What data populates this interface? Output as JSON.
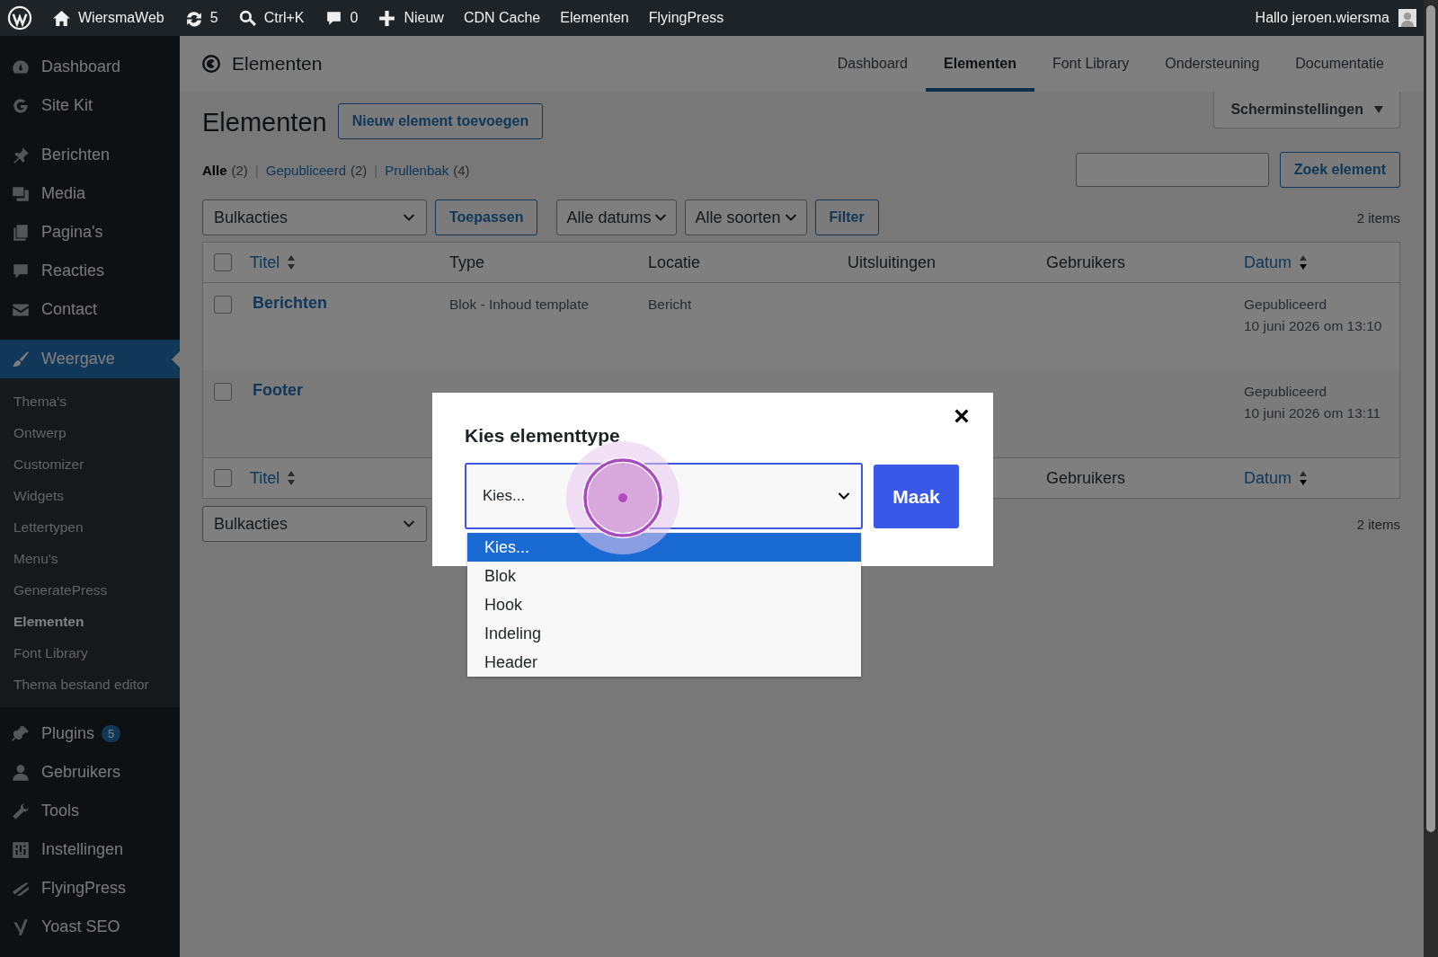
{
  "admin_bar": {
    "items": [
      {
        "label": "WiersmaWeb"
      },
      {
        "label": "5"
      },
      {
        "label": "Ctrl+K"
      },
      {
        "label": "0"
      },
      {
        "label": "Nieuw"
      },
      {
        "label": "CDN Cache"
      },
      {
        "label": "Elementen"
      },
      {
        "label": "FlyingPress"
      }
    ],
    "greeting": "Hallo jeroen.wiersma"
  },
  "sidebar": {
    "groups": [
      [
        {
          "label": "Dashboard",
          "selected": false
        },
        {
          "label": "Site Kit",
          "selected": false
        }
      ],
      [
        {
          "label": "Berichten",
          "selected": false
        },
        {
          "label": "Media",
          "selected": false
        },
        {
          "label": "Pagina's",
          "selected": false
        },
        {
          "label": "Reacties",
          "selected": false
        },
        {
          "label": "Contact",
          "selected": false
        }
      ],
      [
        {
          "label": "Weergave",
          "selected": true,
          "children": [
            {
              "label": "Thema's",
              "selected": false
            },
            {
              "label": "Ontwerp",
              "selected": false
            },
            {
              "label": "Customizer",
              "selected": false
            },
            {
              "label": "Widgets",
              "selected": false
            },
            {
              "label": "Lettertypen",
              "selected": false
            },
            {
              "label": "Menu's",
              "selected": false
            },
            {
              "label": "GeneratePress",
              "selected": false
            },
            {
              "label": "Elementen",
              "selected": true
            },
            {
              "label": "Font Library",
              "selected": false
            },
            {
              "label": "Thema bestand editor",
              "selected": false
            }
          ]
        },
        {
          "label": "Plugins",
          "selected": false,
          "badge": "5"
        },
        {
          "label": "Gebruikers",
          "selected": false
        },
        {
          "label": "Tools",
          "selected": false
        },
        {
          "label": "Instellingen",
          "selected": false
        },
        {
          "label": "FlyingPress",
          "selected": false
        },
        {
          "label": "Yoast SEO",
          "selected": false
        }
      ]
    ]
  },
  "plugin_header": {
    "title": "Elementen",
    "tabs": [
      {
        "label": "Dashboard",
        "selected": false
      },
      {
        "label": "Elementen",
        "selected": true
      },
      {
        "label": "Font Library",
        "selected": false
      },
      {
        "label": "Ondersteuning",
        "selected": false
      },
      {
        "label": "Documentatie",
        "selected": false
      }
    ]
  },
  "page": {
    "title": "Elementen",
    "add_button": "Nieuw element toevoegen",
    "screen_options": "Scherminstellingen",
    "views": [
      {
        "label": "Alle",
        "count": "(2)",
        "selected": true
      },
      {
        "separator": "|",
        "label": "Gepubliceerd",
        "count": "(2)",
        "selected": false
      },
      {
        "separator": "|",
        "label": "Prullenbak",
        "count": "(4)",
        "selected": false
      }
    ],
    "search_button": "Zoek element",
    "bulk_actions": "Bulkacties",
    "apply_button": "Toepassen",
    "filters": [
      "Alle datums",
      "Alle soorten"
    ],
    "filter_button": "Filter",
    "count": "2 items",
    "table": {
      "select_all_checked": false,
      "columns": [
        {
          "label": "Titel",
          "kind": "sortable"
        },
        {
          "label": "Type",
          "kind": "plain"
        },
        {
          "label": "Locatie",
          "kind": "plain"
        },
        {
          "label": "Uitsluitingen",
          "kind": "plain"
        },
        {
          "label": "Gebruikers",
          "kind": "plain"
        },
        {
          "label": "Datum",
          "kind": "sorted"
        }
      ],
      "rows": [
        {
          "checked": false,
          "title": "Berichten",
          "type": "Blok - Inhoud template",
          "location": "Bericht",
          "status": "Gepubliceerd",
          "date": "10 juni 2026 om 13:10"
        },
        {
          "checked": false,
          "title": "Footer",
          "status": "Gepubliceerd",
          "date": "10 juni 2026 om 13:11"
        }
      ],
      "footer_select_all_checked": false,
      "footer_columns": [
        {
          "label": "Titel",
          "kind": "sortable"
        },
        {
          "label": "Gebruikers",
          "kind": "plain"
        },
        {
          "label": "Datum",
          "kind": "sorted"
        }
      ]
    },
    "bottom_bulk_actions": "Bulkacties",
    "bottom_count": "2 items"
  },
  "modal": {
    "title": "Kies elementtype",
    "select_value": "Kies...",
    "create_button": "Maak",
    "options": [
      {
        "label": "Kies...",
        "selected": true
      },
      {
        "label": "Blok",
        "selected": false
      },
      {
        "label": "Hook",
        "selected": false
      },
      {
        "label": "Indeling",
        "selected": false
      },
      {
        "label": "Header",
        "selected": false
      }
    ]
  }
}
